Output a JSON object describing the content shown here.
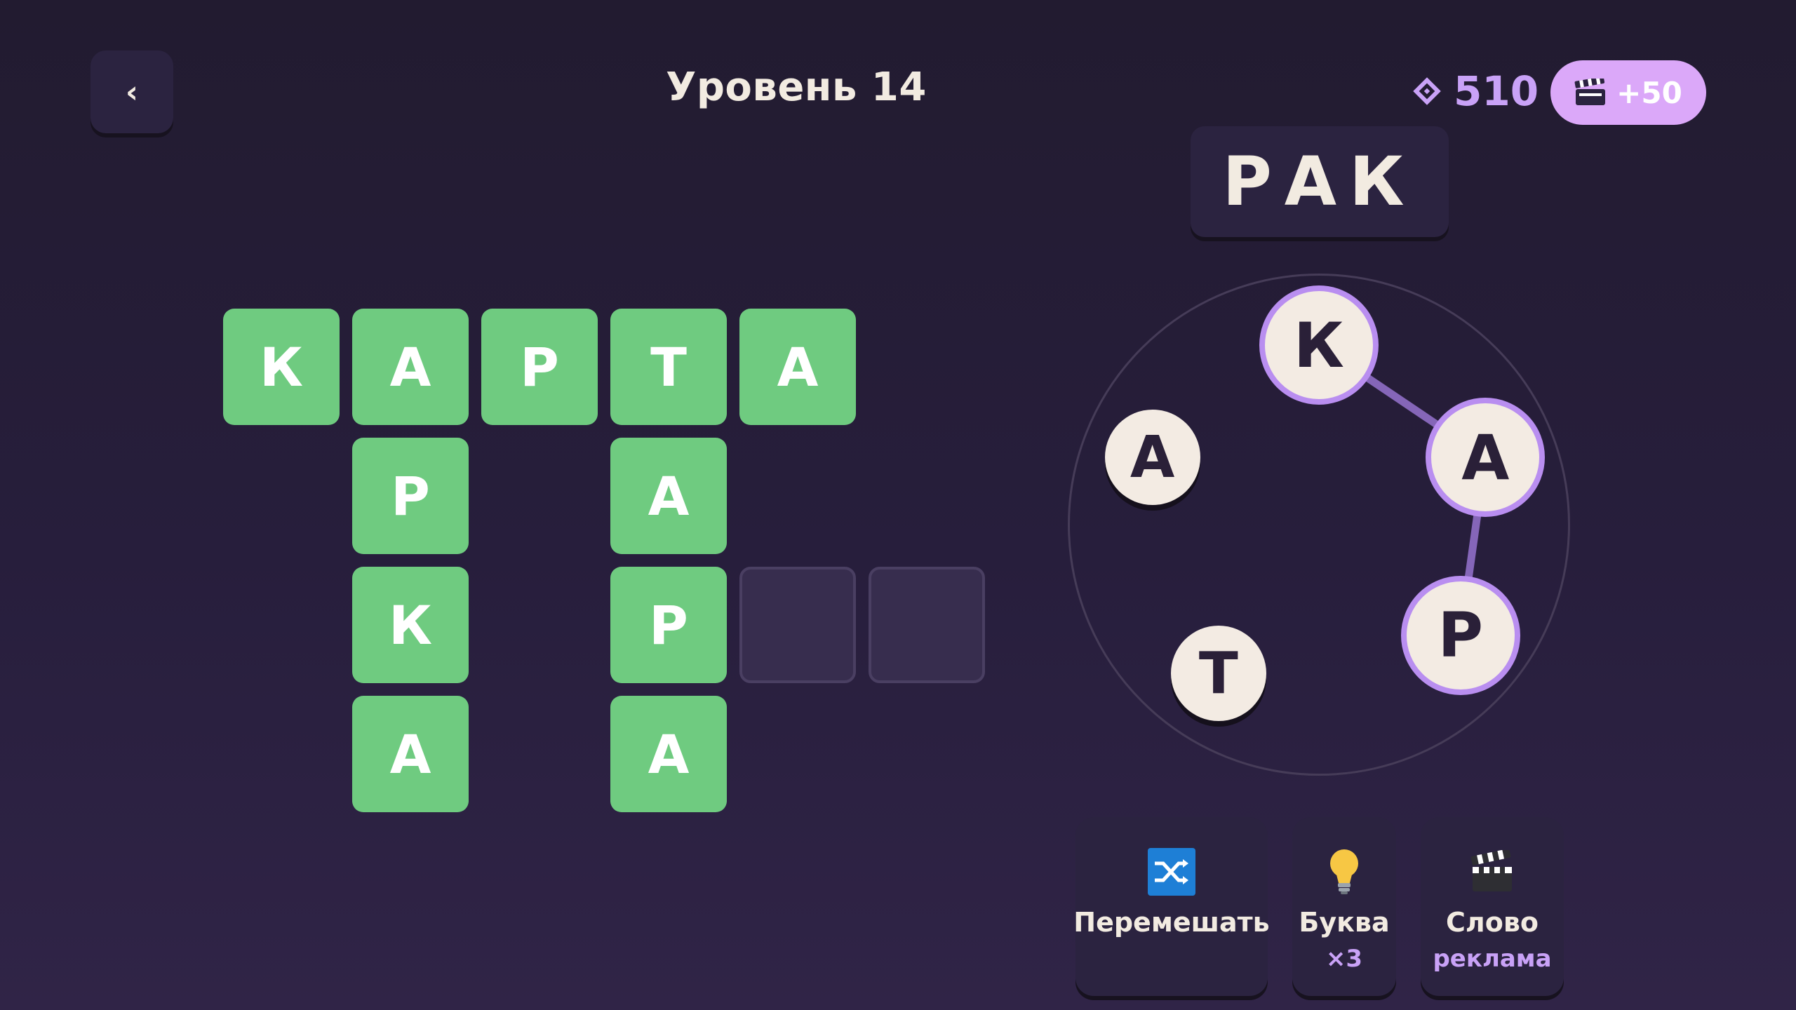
{
  "header": {
    "back_label": "‹",
    "level_title": "Уровень 14",
    "gems": "510",
    "ad_bonus": "+50"
  },
  "current_word": "РАК",
  "grid": {
    "tiles": [
      {
        "letter": "К",
        "col": 0,
        "row": 0
      },
      {
        "letter": "А",
        "col": 1,
        "row": 0
      },
      {
        "letter": "Р",
        "col": 2,
        "row": 0
      },
      {
        "letter": "Т",
        "col": 3,
        "row": 0
      },
      {
        "letter": "А",
        "col": 4,
        "row": 0
      },
      {
        "letter": "Р",
        "col": 1,
        "row": 1
      },
      {
        "letter": "К",
        "col": 1,
        "row": 2
      },
      {
        "letter": "А",
        "col": 1,
        "row": 3
      },
      {
        "letter": "А",
        "col": 3,
        "row": 1
      },
      {
        "letter": "Р",
        "col": 3,
        "row": 2
      },
      {
        "letter": "А",
        "col": 3,
        "row": 3
      },
      {
        "letter": "",
        "col": 4,
        "row": 2
      },
      {
        "letter": "",
        "col": 5,
        "row": 2
      }
    ]
  },
  "wheel": {
    "letters": [
      "К",
      "А",
      "Р",
      "Т",
      "А"
    ],
    "selected_order": [
      0,
      1,
      2
    ]
  },
  "tools": {
    "shuffle": {
      "label": "Перемешать",
      "icon": "shuffle-icon"
    },
    "letter": {
      "label": "Буква",
      "sub": "×3",
      "icon": "lightbulb-icon"
    },
    "word": {
      "label": "Слово",
      "sub": "реклама",
      "icon": "clapperboard-icon"
    }
  },
  "colors": {
    "tile_filled": "#6fcb80",
    "accent": "#c9a2f7",
    "bonus_pill": "#dba8f9",
    "panel": "#2b2340"
  }
}
